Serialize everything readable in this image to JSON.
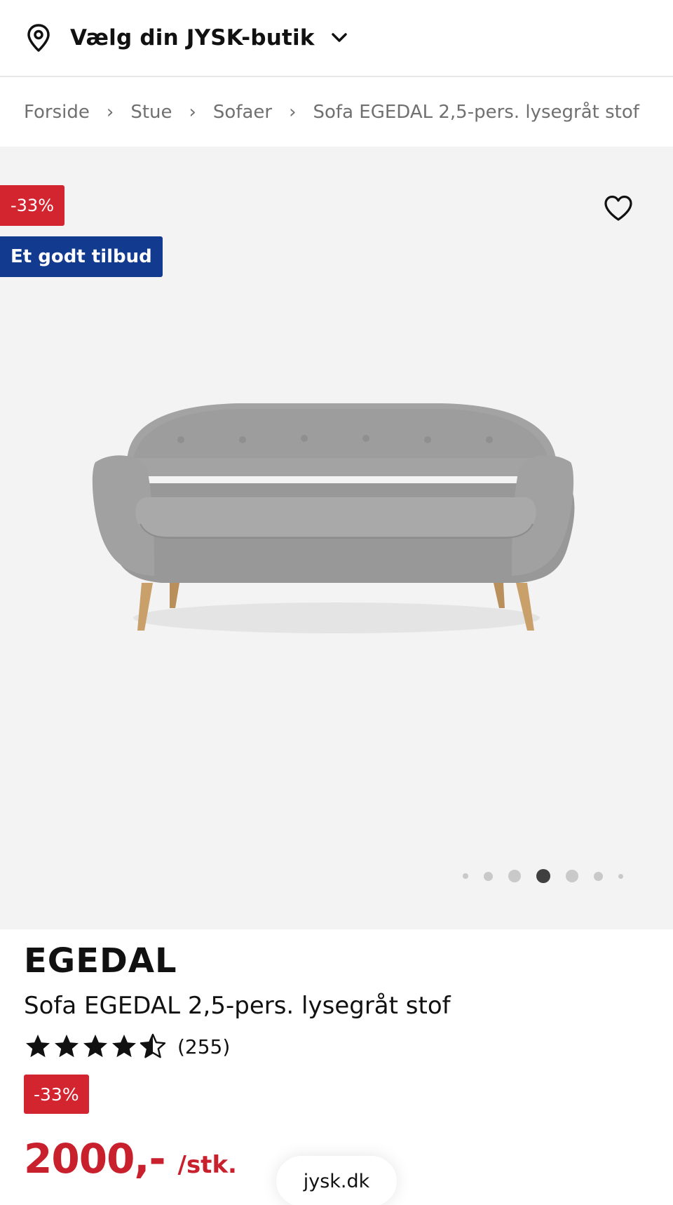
{
  "header": {
    "store_label": "Vælg din JYSK-butik"
  },
  "breadcrumb": {
    "items": [
      "Forside",
      "Stue",
      "Sofaer",
      "Sofa EGEDAL 2,5-pers. lysegråt stof"
    ],
    "separator": "›"
  },
  "gallery": {
    "discount_badge": "-33%",
    "offer_badge": "Et godt tilbud",
    "active_image_index": 3,
    "image_count": 7
  },
  "product": {
    "brand": "EGEDAL",
    "name": "Sofa EGEDAL 2,5-pers. lysegråt stof",
    "rating": 4.5,
    "rating_max": 5,
    "review_count": "(255)",
    "discount_badge": "-33%",
    "price": "2000,-",
    "unit": "/stk."
  },
  "browser": {
    "domain": "jysk.dk"
  },
  "colors": {
    "discount_red": "#d2252f",
    "offer_blue": "#123a8f",
    "price_red": "#c8202c"
  }
}
